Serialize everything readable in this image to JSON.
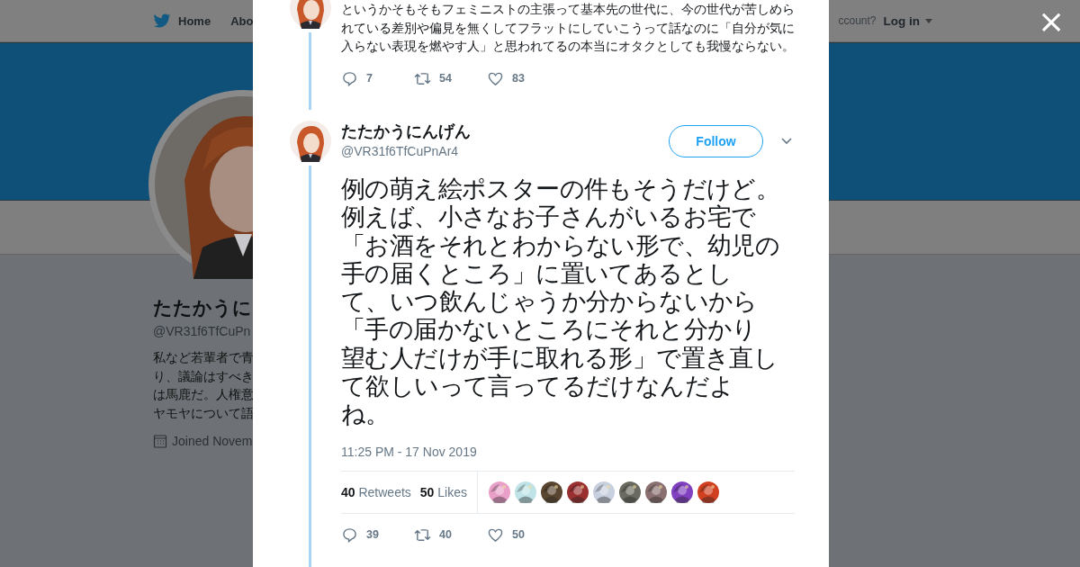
{
  "background": {
    "nav": {
      "home": "Home",
      "about": "Abo",
      "account": "ccount?",
      "login": "Log in"
    },
    "profile": {
      "name": "たたかうに",
      "handle": "@VR31f6TfCuPn",
      "bio": [
        "私など若輩者で青",
        "り、議論はすべき",
        "は馬鹿だ。人権意",
        "ヤモヤについて語"
      ],
      "joined": "Joined Novem"
    }
  },
  "modal": {
    "close": "×",
    "previous_tweet": {
      "text": "というかそもそもフェミニストの主張って基本先の世代に、今の世代が苦しめられている差別や偏見を無くしてフラットにしていこうって話なのに「自分が気に入らない表現を燃やす人」と思われてるの本当にオタクとしても我慢ならない。",
      "replies": "7",
      "retweets": "54",
      "likes": "83"
    },
    "tweet": {
      "name": "たたかうにんげん",
      "handle": "@VR31f6TfCuPnAr4",
      "follow": "Follow",
      "text": [
        "例の萌え絵ポスターの件もそうだけど。",
        "例えば、小さなお子さんがいるお宅で「お酒をそれとわからない形で、幼児の手の届くところ」に置いてあるとして、いつ飲んじゃうか分からないから「手の届かないところにそれと分かり望む人だけが手に取れる形」で置き直して欲しいって言ってるだけなんだよね。"
      ],
      "time": "11:25 PM - 17 Nov 2019",
      "retweet_count": "40",
      "retweet_label": "Retweets",
      "like_count": "50",
      "like_label": "Likes",
      "likers": [
        {
          "color": "#e8a0c8"
        },
        {
          "color": "#bfe3e6"
        },
        {
          "color": "#5a4630"
        },
        {
          "color": "#9a3030"
        },
        {
          "color": "#c8d0e0"
        },
        {
          "color": "#6a6a60"
        },
        {
          "color": "#8a7070"
        },
        {
          "color": "#8040c0"
        },
        {
          "color": "#d04020"
        }
      ],
      "replies": "39",
      "retweets": "40",
      "likes": "50"
    }
  }
}
